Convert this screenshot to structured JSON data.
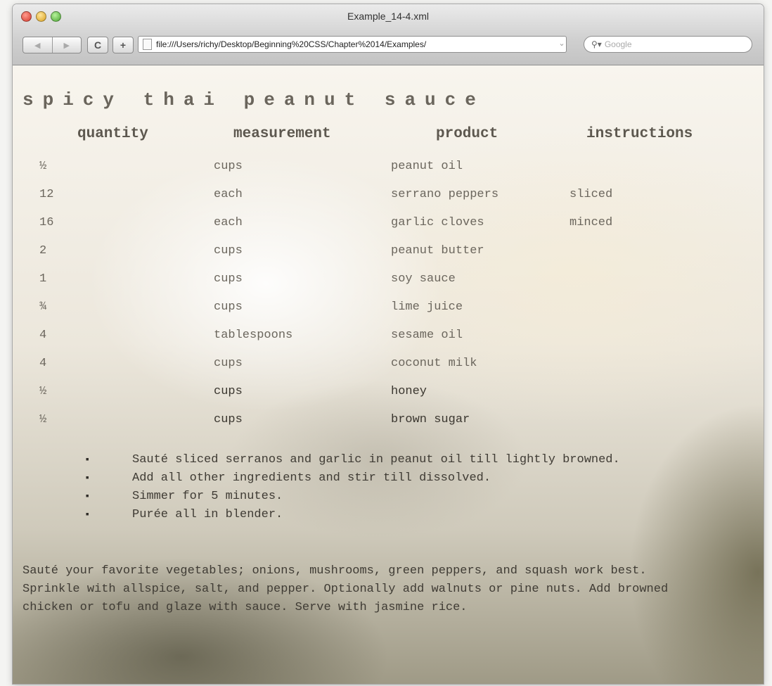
{
  "window": {
    "title": "Example_14-4.xml"
  },
  "toolbar": {
    "back": "◀",
    "forward": "▶",
    "reload": "C",
    "add": "+",
    "url": "file:///Users/richy/Desktop/Beginning%20CSS/Chapter%2014/Examples/",
    "search_placeholder": "Google"
  },
  "recipe": {
    "title": "spicy thai peanut sauce",
    "headers": [
      "quantity",
      "measurement",
      "product",
      "instructions"
    ],
    "rows": [
      [
        "½",
        "cups",
        "peanut oil",
        ""
      ],
      [
        "12",
        "each",
        "serrano peppers",
        "sliced"
      ],
      [
        "16",
        "each",
        "garlic cloves",
        "minced"
      ],
      [
        "2",
        "cups",
        "peanut butter",
        ""
      ],
      [
        "1",
        "cups",
        "soy sauce",
        ""
      ],
      [
        "¾",
        "cups",
        "lime juice",
        ""
      ],
      [
        "4",
        "tablespoons",
        "sesame oil",
        ""
      ],
      [
        "4",
        "cups",
        "coconut milk",
        ""
      ],
      [
        "½",
        "cups",
        "honey",
        ""
      ],
      [
        "½",
        "cups",
        "brown sugar",
        ""
      ]
    ],
    "steps": [
      "Sauté sliced serranos and garlic in peanut oil till lightly browned.",
      "Add all other ingredients and stir till dissolved.",
      "Simmer for 5 minutes.",
      "Purée all in blender."
    ],
    "note": "Sauté your favorite vegetables; onions, mushrooms, green peppers, and squash work best. Sprinkle with allspice, salt, and pepper. Optionally add walnuts or pine nuts. Add browned chicken or tofu and glaze with sauce. Serve with jasmine rice."
  }
}
